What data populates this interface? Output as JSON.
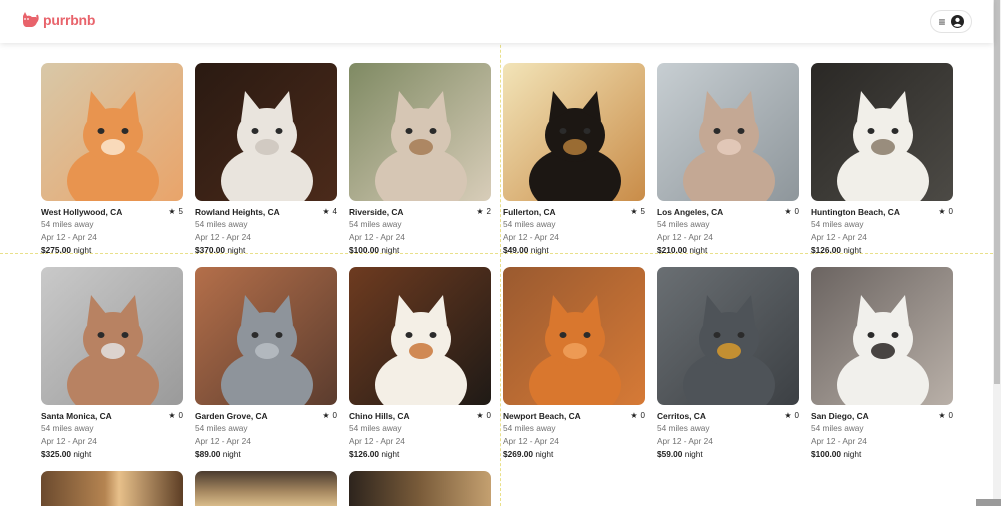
{
  "brand": {
    "name": "purrbnb",
    "color": "#e8636b"
  },
  "header": {
    "menu_icon": "hamburger-icon",
    "user_icon": "user-circle-icon"
  },
  "listings": [
    {
      "location": "West Hollywood, CA",
      "rating": "5",
      "distance": "54 miles away",
      "dates": "Apr 12 - Apr 24",
      "price": "$275.00",
      "unit": "night"
    },
    {
      "location": "Rowland Heights, CA",
      "rating": "4",
      "distance": "54 miles away",
      "dates": "Apr 12 - Apr 24",
      "price": "$370.00",
      "unit": "night"
    },
    {
      "location": "Riverside, CA",
      "rating": "2",
      "distance": "54 miles away",
      "dates": "Apr 12 - Apr 24",
      "price": "$100.00",
      "unit": "night"
    },
    {
      "location": "Fullerton, CA",
      "rating": "5",
      "distance": "54 miles away",
      "dates": "Apr 12 - Apr 24",
      "price": "$49.00",
      "unit": "night"
    },
    {
      "location": "Los Angeles, CA",
      "rating": "0",
      "distance": "54 miles away",
      "dates": "Apr 12 - Apr 24",
      "price": "$210.00",
      "unit": "night"
    },
    {
      "location": "Huntington Beach, CA",
      "rating": "0",
      "distance": "54 miles away",
      "dates": "Apr 12 - Apr 24",
      "price": "$126.00",
      "unit": "night"
    },
    {
      "location": "Santa Monica, CA",
      "rating": "0",
      "distance": "54 miles away",
      "dates": "Apr 12 - Apr 24",
      "price": "$325.00",
      "unit": "night"
    },
    {
      "location": "Garden Grove, CA",
      "rating": "0",
      "distance": "54 miles away",
      "dates": "Apr 12 - Apr 24",
      "price": "$89.00",
      "unit": "night"
    },
    {
      "location": "Chino Hills, CA",
      "rating": "0",
      "distance": "54 miles away",
      "dates": "Apr 12 - Apr 24",
      "price": "$126.00",
      "unit": "night"
    },
    {
      "location": "Newport Beach, CA",
      "rating": "0",
      "distance": "54 miles away",
      "dates": "Apr 12 - Apr 24",
      "price": "$269.00",
      "unit": "night"
    },
    {
      "location": "Cerritos, CA",
      "rating": "0",
      "distance": "54 miles away",
      "dates": "Apr 12 - Apr 24",
      "price": "$59.00",
      "unit": "night"
    },
    {
      "location": "San Diego, CA",
      "rating": "0",
      "distance": "54 miles away",
      "dates": "Apr 12 - Apr 24",
      "price": "$100.00",
      "unit": "night"
    }
  ]
}
